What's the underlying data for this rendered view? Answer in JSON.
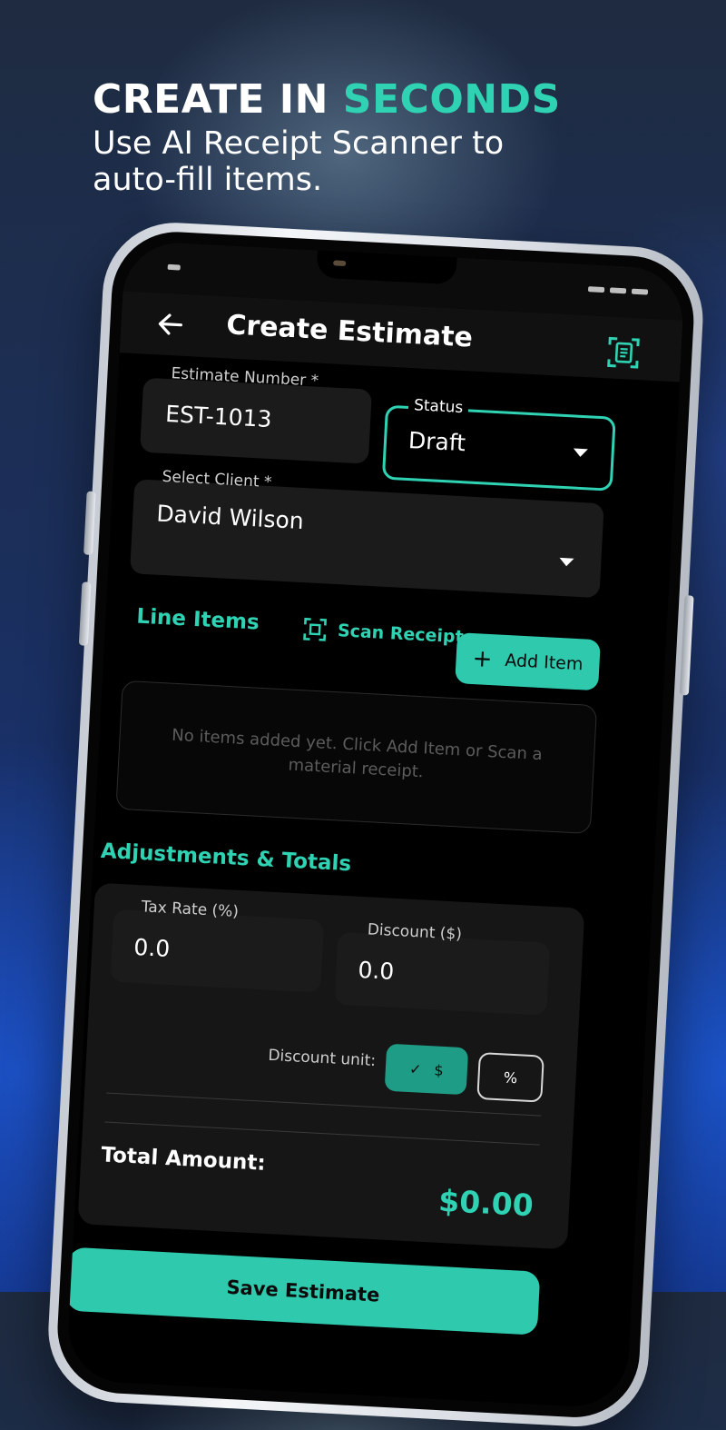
{
  "headline": {
    "title_white": "CREATE IN ",
    "title_accent": "SECONDS",
    "subtitle_line1": "Use AI Receipt Scanner to",
    "subtitle_line2": "auto-fill items."
  },
  "app_bar": {
    "back_icon": "arrow-left-icon",
    "title": "Create Estimate",
    "scan_icon": "document-scan-icon"
  },
  "form": {
    "estimate_number": {
      "label": "Estimate Number *",
      "value": "EST-1013"
    },
    "status": {
      "label": "Status",
      "value": "Draft"
    },
    "client": {
      "label": "Select Client *",
      "value": "David Wilson"
    }
  },
  "line_items": {
    "title": "Line Items",
    "scan_receipt_label": "Scan Receipt",
    "add_item_label": "Add Item",
    "empty_message": "No items added yet. Click Add Item or Scan a material receipt."
  },
  "totals": {
    "title": "Adjustments & Totals",
    "tax_rate": {
      "label": "Tax Rate (%)",
      "value": "0.0"
    },
    "discount": {
      "label": "Discount ($)",
      "value": "0.0"
    },
    "discount_unit_label": "Discount unit:",
    "unit_dollar": "$",
    "unit_percent": "%",
    "unit_selected": "$",
    "total_label": "Total Amount:",
    "total_value": "$0.00"
  },
  "footer": {
    "save_label": "Save Estimate"
  },
  "colors": {
    "accent": "#2fd3b4",
    "button": "#2fc9ad",
    "screen_bg": "#000000",
    "field_bg": "#1b1b1b"
  }
}
